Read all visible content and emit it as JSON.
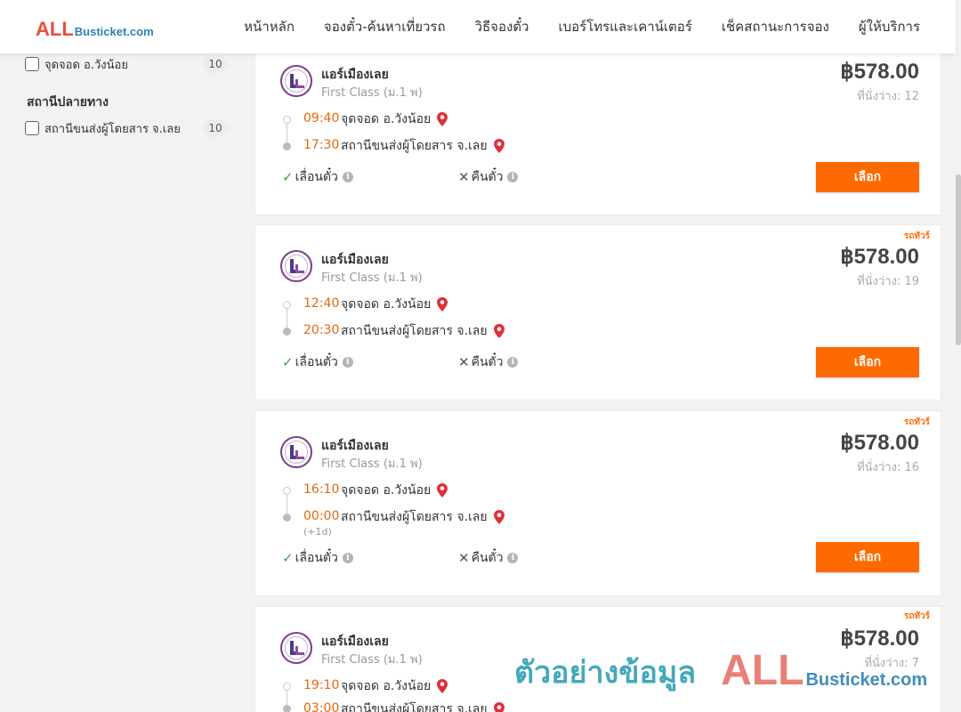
{
  "header": {
    "logo_all": "ALL",
    "logo_rest": "Busticket.com",
    "nav": [
      "หน้าหลัก",
      "จองตั๋ว-ค้นหาเที่ยวรถ",
      "วิธีจองตั๋ว",
      "เบอร์โทรและเคาน์เตอร์",
      "เช็คสถานะการจอง",
      "ผู้ให้บริการ"
    ]
  },
  "sidebar": {
    "origin_filter": {
      "label": "จุดจอด อ.วังน้อย",
      "count": "10"
    },
    "destination_title": "สถานีปลายทาง",
    "destination_filter": {
      "label": "สถานีขนส่งผู้โดยสาร จ.เลย",
      "count": "10"
    }
  },
  "trips": [
    {
      "vip_tag": "",
      "operator": "แอร์เมืองเลย",
      "class": "First Class (ม.1 พ)",
      "price": "฿578.00",
      "seats": "ที่นั่งว่าง: 12",
      "depart_time": "09:40",
      "depart_stop": "จุดจอด อ.วังน้อย",
      "arrive_time": "17:30",
      "arrive_stop": "สถานีขนส่งผู้โดยสาร จ.เลย",
      "next_day": "",
      "reschedule": "เลื่อนตั๋ว",
      "refund": "คืนตั๋ว",
      "select_label": "เลือก"
    },
    {
      "vip_tag": "รถทัวร์",
      "operator": "แอร์เมืองเลย",
      "class": "First Class (ม.1 พ)",
      "price": "฿578.00",
      "seats": "ที่นั่งว่าง: 19",
      "depart_time": "12:40",
      "depart_stop": "จุดจอด อ.วังน้อย",
      "arrive_time": "20:30",
      "arrive_stop": "สถานีขนส่งผู้โดยสาร จ.เลย",
      "next_day": "",
      "reschedule": "เลื่อนตั๋ว",
      "refund": "คืนตั๋ว",
      "select_label": "เลือก"
    },
    {
      "vip_tag": "รถทัวร์",
      "operator": "แอร์เมืองเลย",
      "class": "First Class (ม.1 พ)",
      "price": "฿578.00",
      "seats": "ที่นั่งว่าง: 16",
      "depart_time": "16:10",
      "depart_stop": "จุดจอด อ.วังน้อย",
      "arrive_time": "00:00",
      "arrive_stop": "สถานีขนส่งผู้โดยสาร จ.เลย",
      "next_day": "(+1d)",
      "reschedule": "เลื่อนตั๋ว",
      "refund": "คืนตั๋ว",
      "select_label": "เลือก"
    },
    {
      "vip_tag": "รถทัวร์",
      "operator": "แอร์เมืองเลย",
      "class": "First Class (ม.1 พ)",
      "price": "฿578.00",
      "seats": "ที่นั่งว่าง: 7",
      "depart_time": "19:10",
      "depart_stop": "จุดจอด อ.วังน้อย",
      "arrive_time": "03:00",
      "arrive_stop": "สถานีขนส่งผู้โดยสาร จ.เลย"
    }
  ],
  "watermark": {
    "text": "ตัวอย่างข้อมูล",
    "all": "ALL",
    "rest": "Busticket.com"
  },
  "colors": {
    "accent": "#ff6a00",
    "time": "#e8660b",
    "pin": "#e0303a",
    "check": "#3ea33e"
  }
}
